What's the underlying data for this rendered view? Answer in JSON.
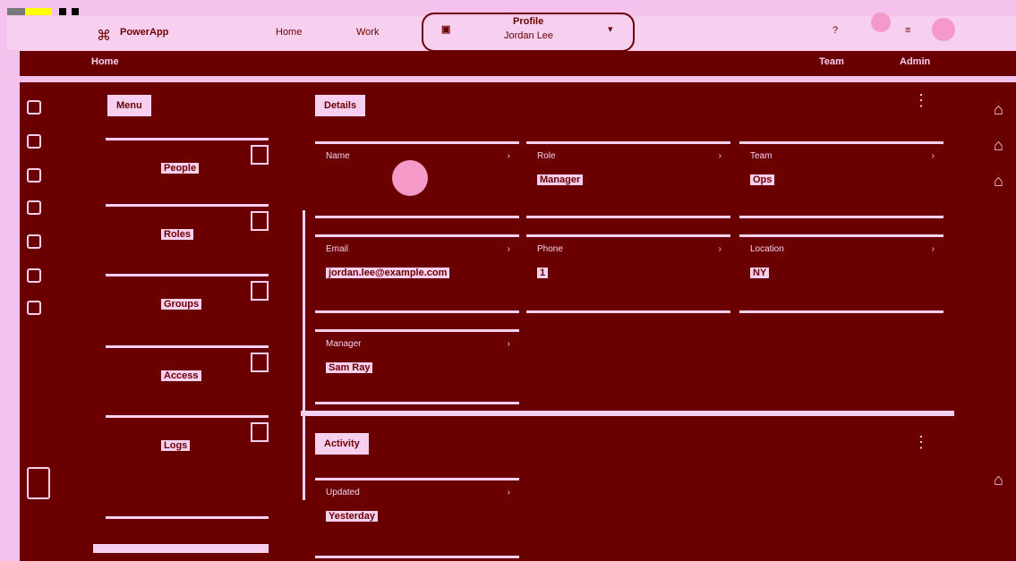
{
  "window": {
    "brand": "PowerApp",
    "nav_left": [
      "Home",
      "Work"
    ],
    "center_title": "Profile",
    "center_sub": "Jordan Lee",
    "right_items": [
      "Help",
      "Alerts"
    ]
  },
  "subbar": {
    "left": "Home",
    "right": [
      "Team",
      "Admin"
    ]
  },
  "left_rail": {
    "icons": [
      "home-icon",
      "people-icon",
      "chart-icon",
      "folder-icon",
      "settings-icon",
      "help-icon",
      "logout-icon"
    ]
  },
  "nav": {
    "title": "Menu",
    "items": [
      {
        "label": "People"
      },
      {
        "label": "Roles"
      },
      {
        "label": "Groups"
      },
      {
        "label": "Access"
      },
      {
        "label": "Logs"
      }
    ]
  },
  "panel1": {
    "title": "Details",
    "cards": [
      {
        "k": "Name",
        "v": ""
      },
      {
        "k": "Role",
        "v": "Manager"
      },
      {
        "k": "Team",
        "v": "Ops"
      },
      {
        "k": "Email",
        "v": "jordan.lee@example.com"
      },
      {
        "k": "Phone",
        "v": "1"
      },
      {
        "k": "Location",
        "v": "NY"
      },
      {
        "k": "Manager",
        "v": "Sam Ray"
      }
    ]
  },
  "panel2": {
    "title": "Activity",
    "cards": [
      {
        "k": "Updated",
        "v": "Yesterday"
      }
    ]
  },
  "colors": {
    "accent": "#6b0000",
    "surface": "#f7d0f0",
    "highlight": "#f59ac8"
  }
}
